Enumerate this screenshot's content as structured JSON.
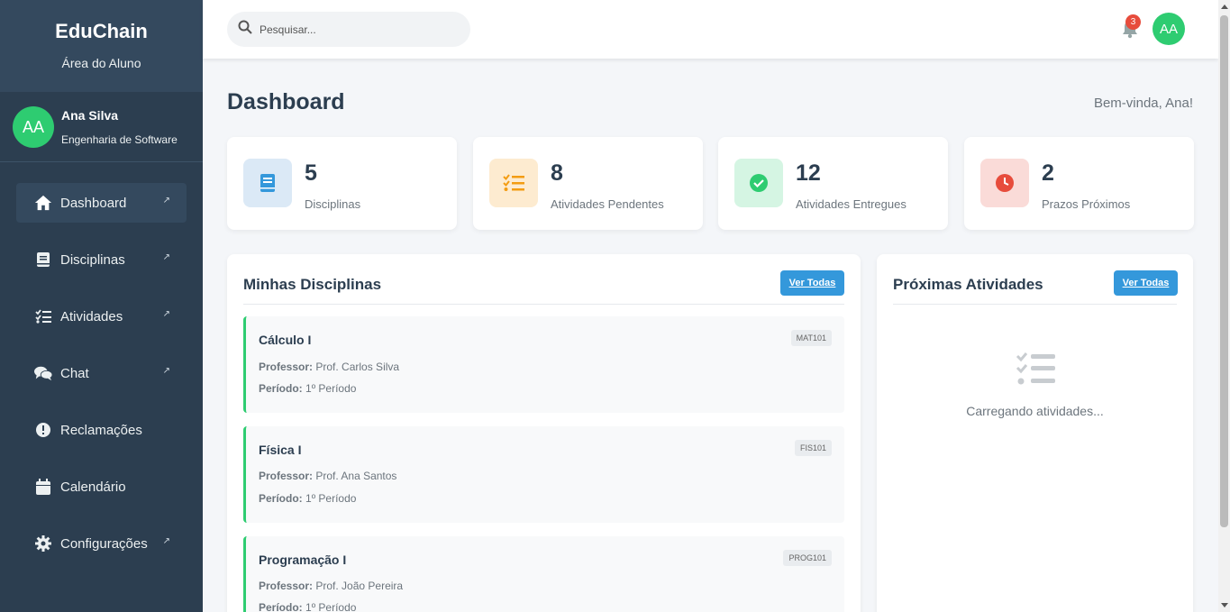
{
  "brand": {
    "name": "EduChain",
    "subtitle": "Área do Aluno"
  },
  "user": {
    "initials": "AA",
    "name": "Ana Silva",
    "course": "Engenharia de Software"
  },
  "nav": [
    {
      "label": "Dashboard",
      "icon": "home-icon",
      "active": true,
      "arrow": "↗"
    },
    {
      "label": "Disciplinas",
      "icon": "book-icon",
      "arrow": "↗"
    },
    {
      "label": "Atividades",
      "icon": "tasks-icon",
      "arrow": "↗"
    },
    {
      "label": "Chat",
      "icon": "comments-icon",
      "arrow": "↗"
    },
    {
      "label": "Reclamações",
      "icon": "exclamation-circle-icon"
    },
    {
      "label": "Calendário",
      "icon": "calendar-icon"
    },
    {
      "label": "Configurações",
      "icon": "gear-icon",
      "arrow": "↗"
    }
  ],
  "header": {
    "search_placeholder": "Pesquisar...",
    "notification_count": "3",
    "avatar_initials": "AA"
  },
  "page": {
    "title": "Dashboard",
    "welcome": "Bem-vinda, Ana!"
  },
  "stats": [
    {
      "value": "5",
      "label": "Disciplinas",
      "icon": "book-icon",
      "color": "#3498db",
      "bg": "#dbe9f6"
    },
    {
      "value": "8",
      "label": "Atividades Pendentes",
      "icon": "tasks-icon",
      "color": "#f39c12",
      "bg": "#fdebd0"
    },
    {
      "value": "12",
      "label": "Atividades Entregues",
      "icon": "check-circle-icon",
      "color": "#2ecc71",
      "bg": "#d5f5e3"
    },
    {
      "value": "2",
      "label": "Prazos Próximos",
      "icon": "clock-icon",
      "color": "#e74c3c",
      "bg": "#fadbd8"
    }
  ],
  "courses_panel": {
    "title": "Minhas Disciplinas",
    "button": "Ver Todas",
    "professor_label": "Professor:",
    "period_label": "Período:",
    "items": [
      {
        "name": "Cálculo I",
        "code": "MAT101",
        "professor": "Prof. Carlos Silva",
        "period": "1º Período"
      },
      {
        "name": "Física I",
        "code": "FIS101",
        "professor": "Prof. Ana Santos",
        "period": "1º Período"
      },
      {
        "name": "Programação I",
        "code": "PROG101",
        "professor": "Prof. João Pereira",
        "period": "1º Período"
      }
    ]
  },
  "activities_panel": {
    "title": "Próximas Atividades",
    "button": "Ver Todas",
    "loading": "Carregando atividades..."
  },
  "colors": {
    "sidebar": "#2c3e50",
    "accent": "#3498db",
    "success": "#2ecc71",
    "danger": "#e74c3c"
  }
}
